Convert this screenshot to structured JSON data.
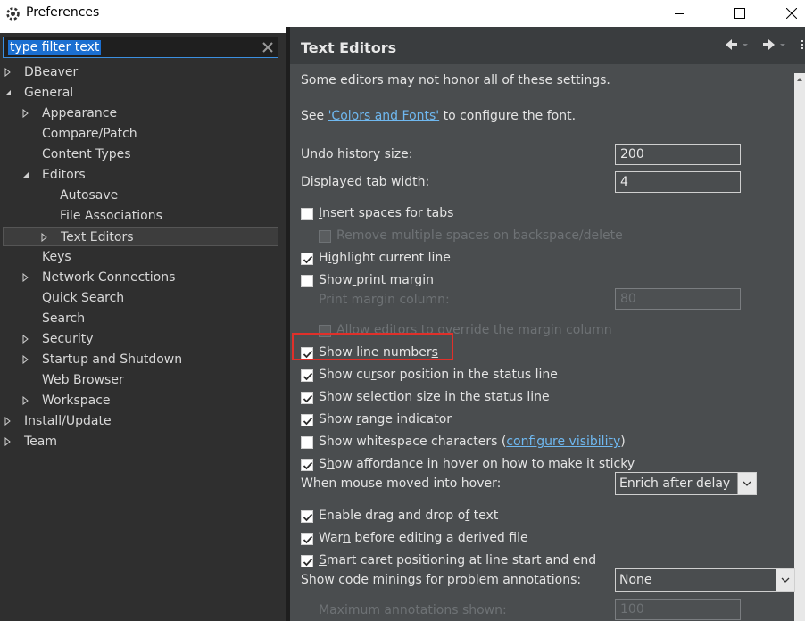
{
  "window": {
    "title": "Preferences",
    "app_icon": "eclipse-gear-icon",
    "controls": [
      "minimize-icon",
      "maximize-icon",
      "close-icon"
    ]
  },
  "filter": {
    "value": "type filter text"
  },
  "tree": [
    {
      "label": "DBeaver",
      "level": 0,
      "twisty": "collapsed"
    },
    {
      "label": "General",
      "level": 0,
      "twisty": "expanded"
    },
    {
      "label": "Appearance",
      "level": 1,
      "twisty": "collapsed"
    },
    {
      "label": "Compare/Patch",
      "level": 1,
      "twisty": "none"
    },
    {
      "label": "Content Types",
      "level": 1,
      "twisty": "none"
    },
    {
      "label": "Editors",
      "level": 1,
      "twisty": "expanded"
    },
    {
      "label": "Autosave",
      "level": 2,
      "twisty": "none"
    },
    {
      "label": "File Associations",
      "level": 2,
      "twisty": "none"
    },
    {
      "label": "Text Editors",
      "level": 2,
      "twisty": "collapsed",
      "selected": true
    },
    {
      "label": "Keys",
      "level": 1,
      "twisty": "none"
    },
    {
      "label": "Network Connections",
      "level": 1,
      "twisty": "collapsed"
    },
    {
      "label": "Quick Search",
      "level": 1,
      "twisty": "none"
    },
    {
      "label": "Search",
      "level": 1,
      "twisty": "none"
    },
    {
      "label": "Security",
      "level": 1,
      "twisty": "collapsed"
    },
    {
      "label": "Startup and Shutdown",
      "level": 1,
      "twisty": "collapsed"
    },
    {
      "label": "Web Browser",
      "level": 1,
      "twisty": "none"
    },
    {
      "label": "Workspace",
      "level": 1,
      "twisty": "collapsed"
    },
    {
      "label": "Install/Update",
      "level": 0,
      "twisty": "collapsed"
    },
    {
      "label": "Team",
      "level": 0,
      "twisty": "collapsed"
    }
  ],
  "page": {
    "title": "Text Editors",
    "note": "Some editors may not honor all of these settings.",
    "see_prefix": "See ",
    "see_link": "'Colors and Fonts'",
    "see_suffix": " to configure the font.",
    "undo_label": "Undo history size:",
    "undo_value": "200",
    "tab_label": "Displayed tab width:",
    "tab_value": "4",
    "insert_spaces": {
      "label": "Insert spaces for tabs",
      "checked": false
    },
    "remove_spaces": {
      "label": "Remove multiple spaces on backspace/delete",
      "checked": false,
      "disabled": true
    },
    "highlight_line": {
      "label": "Highlight current line",
      "checked": true
    },
    "print_margin": {
      "label": "Show print margin",
      "checked": false
    },
    "margin_col_label": "Print margin column:",
    "margin_col_value": "80",
    "allow_override": {
      "label": "Allow editors to override the margin column",
      "checked": false,
      "disabled": true
    },
    "line_numbers": {
      "label": "Show line numbers",
      "checked": true
    },
    "cursor_pos": {
      "label": "Show cursor position in the status line",
      "checked": true
    },
    "selection_size": {
      "label": "Show selection size in the status line",
      "checked": true
    },
    "range_indicator": {
      "label": "Show range indicator",
      "checked": true
    },
    "whitespace": {
      "label_prefix": "Show whitespace characters (",
      "link": "configure visibility",
      "label_suffix": ")",
      "checked": false
    },
    "affordance": {
      "label": "Show affordance in hover on how to make it sticky",
      "checked": true
    },
    "hover_label": "When mouse moved into hover:",
    "hover_value": "Enrich after delay",
    "drag_drop": {
      "label": "Enable drag and drop of text",
      "checked": true
    },
    "warn_derived": {
      "label": "Warn before editing a derived file",
      "checked": true
    },
    "smart_caret": {
      "label": "Smart caret positioning at line start and end",
      "checked": true
    },
    "minings_label": "Show code minings for problem annotations:",
    "minings_value": "None",
    "max_ann_label": "Maximum annotations shown:",
    "max_ann_value": "100"
  }
}
